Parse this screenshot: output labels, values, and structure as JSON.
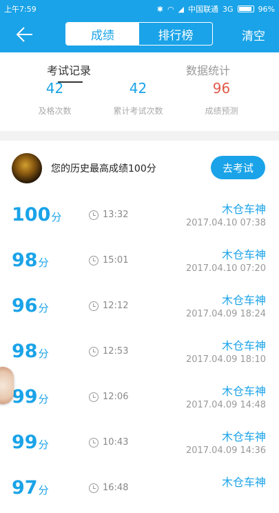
{
  "status": {
    "time": "上午7:59",
    "carrier": "中国联通",
    "network": "3G",
    "battery": "96%",
    "battery_level": 0.96
  },
  "appbar": {
    "tab_scores": "成绩",
    "tab_rank": "排行榜",
    "clear": "清空"
  },
  "tabs": {
    "records": "考试记录",
    "stats": "数据统计"
  },
  "stats": [
    {
      "value": "42",
      "label": "及格次数",
      "color": "#1aa3e8"
    },
    {
      "value": "42",
      "label": "累计考试次数",
      "color": "#1aa3e8"
    },
    {
      "value": "96",
      "label": "成绩预测",
      "color": "#e05a4a"
    }
  ],
  "best": {
    "text": "您的历史最高成绩100分",
    "button": "去考试"
  },
  "records": [
    {
      "score": "100",
      "unit": "分",
      "duration": "13:32",
      "name": "木仓车神",
      "time": "2017.04.10 07:38"
    },
    {
      "score": "98",
      "unit": "分",
      "duration": "15:01",
      "name": "木仓车神",
      "time": "2017.04.10 07:20"
    },
    {
      "score": "96",
      "unit": "分",
      "duration": "12:12",
      "name": "木仓车神",
      "time": "2017.04.09 18:24"
    },
    {
      "score": "98",
      "unit": "分",
      "duration": "12:53",
      "name": "木仓车神",
      "time": "2017.04.09 18:10"
    },
    {
      "score": "99",
      "unit": "分",
      "duration": "12:06",
      "name": "木仓车神",
      "time": "2017.04.09 14:48"
    },
    {
      "score": "99",
      "unit": "分",
      "duration": "10:43",
      "name": "木仓车神",
      "time": "2017.04.09 14:36"
    },
    {
      "score": "97",
      "unit": "分",
      "duration": "16:48",
      "name": "木仓车神",
      "time": ""
    }
  ]
}
